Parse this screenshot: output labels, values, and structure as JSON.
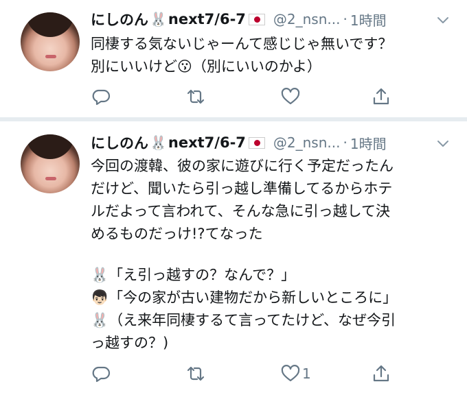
{
  "tweets": [
    {
      "display_name": "にしのん",
      "name_suffix": "next7/6-7",
      "name_emoji": "🐰",
      "handle": "@2_nsn...",
      "dot": "·",
      "time": "1時間",
      "lines": [
        "同棲する気ないじゃーんて感じじゃ無いです？",
        "別にいいけど😗（別にいいのかよ）"
      ],
      "like_count": ""
    },
    {
      "display_name": "にしのん",
      "name_suffix": "next7/6-7",
      "name_emoji": "🐰",
      "handle": "@2_nsn...",
      "dot": "·",
      "time": "1時間",
      "lines": [
        "今回の渡韓、彼の家に遊びに行く予定だったん",
        "だけど、聞いたら引っ越し準備してるからホテ",
        "ルだよって言われて、そんな急に引っ越して決",
        "めるものだっけ!?てなった",
        "",
        "🐰「え引っ越すの？なんで？」",
        "👦🏻「今の家が古い建物だから新しいところに」",
        "🐰（え来年同棲するて言ってたけど、なぜ今引",
        "っ越すの？)"
      ],
      "like_count": "1"
    }
  ],
  "icons": {
    "reply": "reply-icon",
    "retweet": "retweet-icon",
    "like": "heart-icon",
    "share": "share-icon",
    "more": "chevron-down-icon"
  },
  "colors": {
    "text": "#14171a",
    "secondary": "#657786",
    "separator": "#e6ecf0"
  }
}
